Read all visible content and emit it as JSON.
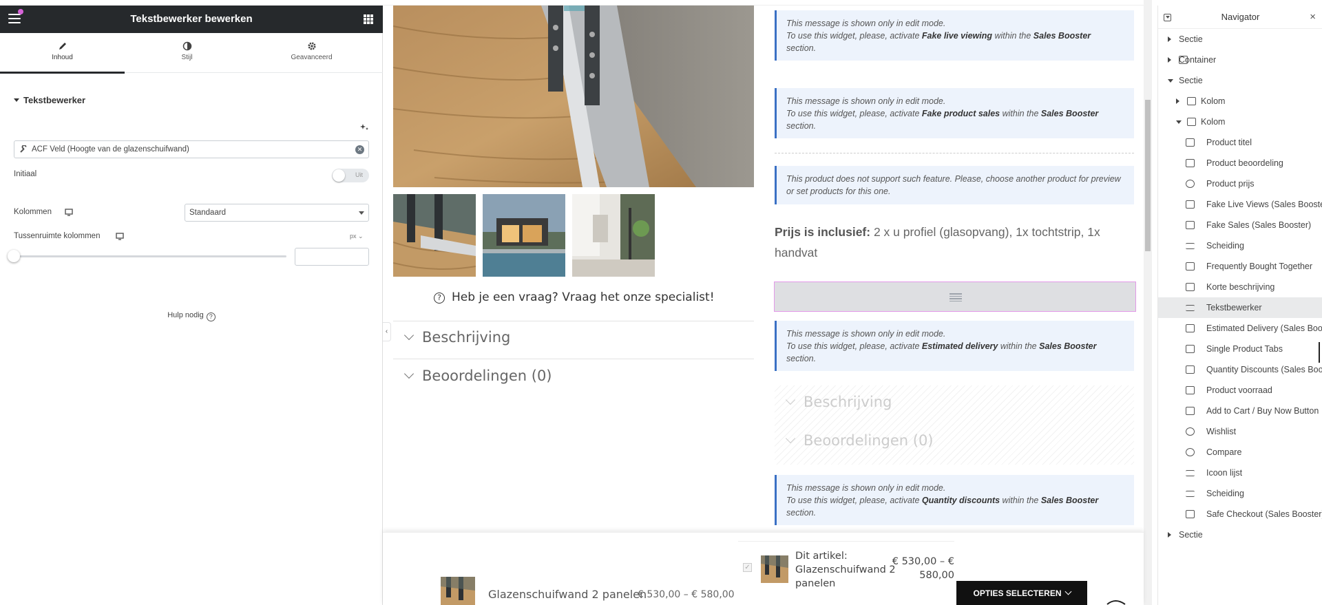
{
  "panel": {
    "title": "Tekstbewerker bewerken",
    "tabs": [
      {
        "label": "Inhoud",
        "icon": "pencil-icon"
      },
      {
        "label": "Stijl",
        "icon": "contrast-icon"
      },
      {
        "label": "Geavanceerd",
        "icon": "gear-icon"
      }
    ],
    "section_title": "Tekstbewerker",
    "acf_field": "ACF Veld (Hoogte van de glazenschuifwand)",
    "initiaal_label": "Initiaal",
    "initiaal_toggle": "Uit",
    "kolommen_label": "Kolommen",
    "kolommen_value": "Standaard",
    "tussenruimte_label": "Tussenruimte kolommen",
    "tussenruimte_unit": "px",
    "tussenruimte_value": "",
    "help_label": "Hulp nodig",
    "accent": "#26292c"
  },
  "canvas": {
    "faq_text": "Heb je een vraag? Vraag het onze specialist!",
    "accordion": [
      "Beschrijving",
      "Beoordelingen (0)"
    ],
    "notes": [
      {
        "l1": "This message is shown only in edit mode.",
        "pre": "To use this widget, please, activate ",
        "feature": "Fake live viewing",
        "mid": " within the ",
        "plugin": "Sales Booster",
        "post": "section."
      },
      {
        "l1": "This message is shown only in edit mode.",
        "pre": "To use this widget, please, activate ",
        "feature": "Fake product sales",
        "mid": " within the ",
        "plugin": "Sales Booster",
        "post": "section."
      },
      {
        "l1": "This product does not support such feature. Please, choose another product for preview or set products for this one."
      },
      {
        "l1": "This message is shown only in edit mode.",
        "pre": "To use this widget, please, activate ",
        "feature": "Estimated delivery",
        "mid": " within the ",
        "plugin": "Sales Booster",
        "post": "section."
      },
      {
        "l1": "This message is shown only in edit mode.",
        "pre": "To use this widget, please, activate ",
        "feature": "Quantity discounts",
        "mid": " within the ",
        "plugin": "Sales Booster",
        "post": "section."
      }
    ],
    "prijs_bold": "Prijs is inclusief:",
    "prijs_text": " 2 x u profiel (glasopvang), 1x tochtstrip, 1x handvat",
    "tabs_placeholder": [
      "Beschrijving",
      "Beoordelingen (0)"
    ],
    "sticky": {
      "product_name": "Glazenschuifwand 2 panelen",
      "product_price": "€ 530,00 – € 580,00",
      "fbt_name": "Dit artikel: Glazenschuifwand 2 panelen",
      "fbt_price": "€ 530,00 – € 580,00",
      "button": "OPTIES SELECTEREN"
    }
  },
  "navigator": {
    "title": "Navigator",
    "items": [
      {
        "label": "Sectie",
        "level": 0,
        "toggle": "collapsed",
        "icon": "none"
      },
      {
        "label": "Container",
        "level": 0,
        "toggle": "collapsed",
        "icon": "container-icon"
      },
      {
        "label": "Sectie",
        "level": 0,
        "toggle": "expanded",
        "icon": "none"
      },
      {
        "label": "Kolom",
        "level": 1,
        "toggle": "collapsed",
        "icon": "column-icon"
      },
      {
        "label": "Kolom",
        "level": 1,
        "toggle": "expanded",
        "icon": "column-icon"
      },
      {
        "label": "Product titel",
        "level": 2,
        "icon": "product-title-icon"
      },
      {
        "label": "Product beoordeling",
        "level": 2,
        "icon": "rating-icon"
      },
      {
        "label": "Product prijs",
        "level": 2,
        "icon": "price-icon"
      },
      {
        "label": "Fake Live Views (Sales Booster)",
        "level": 2,
        "icon": "chart-icon"
      },
      {
        "label": "Fake Sales (Sales Booster)",
        "level": 2,
        "icon": "chart-icon"
      },
      {
        "label": "Scheiding",
        "level": 2,
        "icon": "divider-icon"
      },
      {
        "label": "Frequently Bought Together",
        "level": 2,
        "icon": "cart-icon"
      },
      {
        "label": "Korte beschrijving",
        "level": 2,
        "icon": "short-description-icon"
      },
      {
        "label": "Tekstbewerker",
        "level": 2,
        "icon": "text-editor-icon",
        "selected": true
      },
      {
        "label": "Estimated Delivery (Sales Booster)",
        "level": 2,
        "icon": "chart-icon"
      },
      {
        "label": "Single Product Tabs",
        "level": 2,
        "icon": "tabs-icon"
      },
      {
        "label": "Quantity Discounts (Sales Booster)",
        "level": 2,
        "icon": "chart-icon"
      },
      {
        "label": "Product voorraad",
        "level": 2,
        "icon": "box-icon"
      },
      {
        "label": "Add to Cart / Buy Now Button",
        "level": 2,
        "icon": "button-icon"
      },
      {
        "label": "Wishlist",
        "level": 2,
        "icon": "heart-icon"
      },
      {
        "label": "Compare",
        "level": 2,
        "icon": "refresh-icon"
      },
      {
        "label": "Icoon lijst",
        "level": 2,
        "icon": "list-icon"
      },
      {
        "label": "Scheiding",
        "level": 2,
        "icon": "divider-icon"
      },
      {
        "label": "Safe Checkout (Sales Booster)",
        "level": 2,
        "icon": "cart-icon"
      },
      {
        "label": "Sectie",
        "level": 0,
        "toggle": "collapsed",
        "icon": "none"
      }
    ]
  }
}
